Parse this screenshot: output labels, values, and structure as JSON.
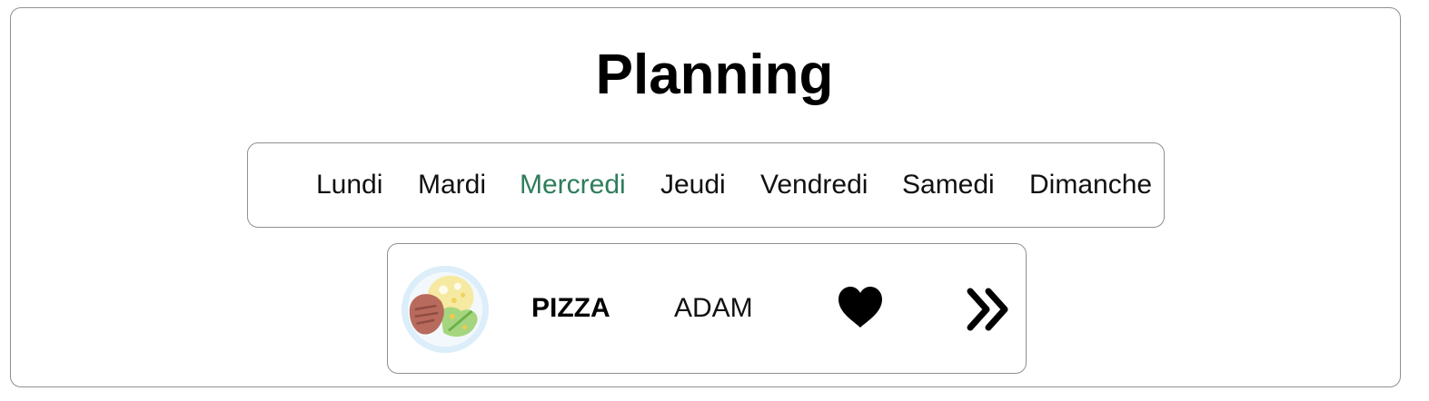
{
  "page": {
    "title": "Planning"
  },
  "days": [
    {
      "label": "Lundi",
      "active": false
    },
    {
      "label": "Mardi",
      "active": false
    },
    {
      "label": "Mercredi",
      "active": true
    },
    {
      "label": "Jeudi",
      "active": false
    },
    {
      "label": "Vendredi",
      "active": false
    },
    {
      "label": "Samedi",
      "active": false
    },
    {
      "label": "Dimanche",
      "active": false
    }
  ],
  "meal": {
    "image_icon": "plate-food-icon",
    "name": "PIZZA",
    "person": "ADAM",
    "favorite_icon": "heart-icon",
    "next_icon": "double-chevron-right-icon"
  },
  "colors": {
    "active_day": "#2e7d5b",
    "border": "#8f8f8f",
    "text": "#111111"
  }
}
